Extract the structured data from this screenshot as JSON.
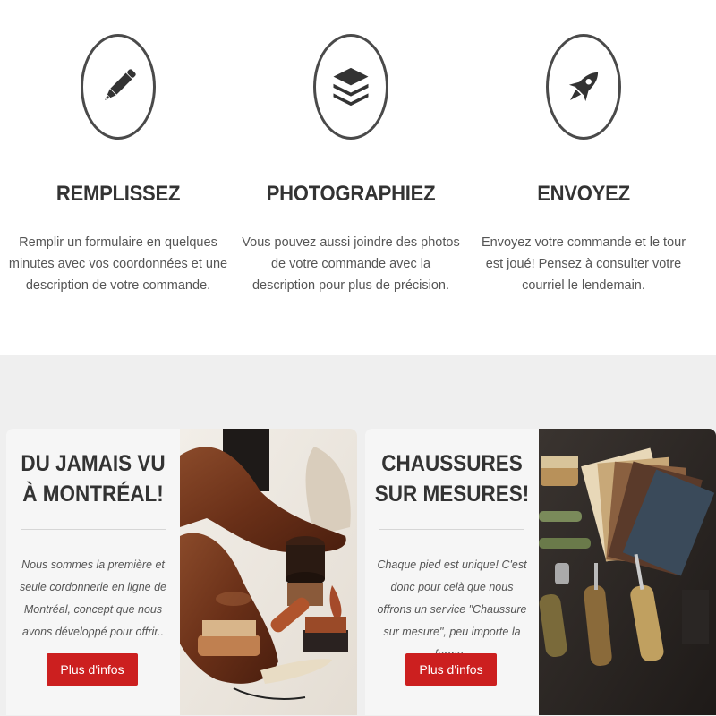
{
  "steps": [
    {
      "title": "REMPLISSEZ",
      "description": "Remplir un formulaire en quelques minutes avec vos coordonnées et une description de votre commande.",
      "icon": "pen-icon"
    },
    {
      "title": "PHOTOGRAPHIEZ",
      "description": "Vous pouvez aussi joindre des photos de votre commande avec la description pour plus de précision.",
      "icon": "layers-icon"
    },
    {
      "title": "ENVOYEZ",
      "description": "Envoyez votre commande et le tour est joué! Pensez à consulter votre courriel le lendemain.",
      "icon": "rocket-icon"
    }
  ],
  "promos": [
    {
      "title_line1": "DU JAMAIS VU",
      "title_line2": "À MONTRÉAL!",
      "description": "Nous sommes la première et seule cordonnerie en ligne de Montréal, concept que nous avons développé pour offrir..",
      "button_label": "Plus d'infos",
      "image": "leather-shoes-and-polish-photo"
    },
    {
      "title_line1": "CHAUSSURES",
      "title_line2": "SUR MESURES!",
      "description": "Chaque pied est unique! C'est donc pour celà que nous offrons un service \"Chaussure sur mesure\", peu importe la forme..",
      "button_label": "Plus d'infos",
      "image": "shoemaker-tools-and-leather-swatches-photo"
    }
  ],
  "colors": {
    "icon_stroke": "#4a4a4a",
    "heading": "#333333",
    "body_text": "#555555",
    "section_bg": "#efefef",
    "button_bg": "#cc1f1f",
    "button_text": "#ffffff"
  }
}
